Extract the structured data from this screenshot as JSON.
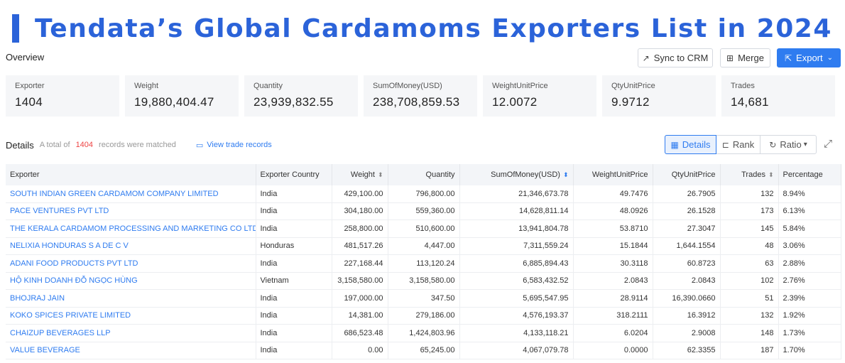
{
  "title": "Tendata’s Global Cardamoms Exporters List in 2024",
  "overview_label": "Overview",
  "buttons": {
    "sync": "Sync to CRM",
    "merge": "Merge",
    "export": "Export"
  },
  "cards": [
    {
      "label": "Exporter",
      "value": "1404"
    },
    {
      "label": "Weight",
      "value": "19,880,404.47"
    },
    {
      "label": "Quantity",
      "value": "23,939,832.55"
    },
    {
      "label": "SumOfMoney(USD)",
      "value": "238,708,859.53"
    },
    {
      "label": "WeightUnitPrice",
      "value": "12.0072"
    },
    {
      "label": "QtyUnitPrice",
      "value": "9.9712"
    },
    {
      "label": "Trades",
      "value": "14,681"
    }
  ],
  "details": {
    "title": "Details",
    "prefix": "A total of",
    "count": "1404",
    "suffix": "records were matched",
    "view_link": "View trade records"
  },
  "view_tabs": {
    "details": "Details",
    "rank": "Rank",
    "ratio": "Ratio"
  },
  "table": {
    "headers": [
      "Exporter",
      "Exporter Country",
      "Weight",
      "Quantity",
      "SumOfMoney(USD)",
      "WeightUnitPrice",
      "QtyUnitPrice",
      "Trades",
      "Percentage"
    ],
    "rows": [
      [
        "SOUTH INDIAN GREEN CARDAMOM COMPANY LIMITED",
        "India",
        "429,100.00",
        "796,800.00",
        "21,346,673.78",
        "49.7476",
        "26.7905",
        "132",
        "8.94%"
      ],
      [
        "PACE VENTURES PVT LTD",
        "India",
        "304,180.00",
        "559,360.00",
        "14,628,811.14",
        "48.0926",
        "26.1528",
        "173",
        "6.13%"
      ],
      [
        "THE KERALA CARDAMOM PROCESSING AND MARKETING CO LTD",
        "India",
        "258,800.00",
        "510,600.00",
        "13,941,804.78",
        "53.8710",
        "27.3047",
        "145",
        "5.84%"
      ],
      [
        "NELIXIA HONDURAS S A DE C V",
        "Honduras",
        "481,517.26",
        "4,447.00",
        "7,311,559.24",
        "15.1844",
        "1,644.1554",
        "48",
        "3.06%"
      ],
      [
        "ADANI FOOD PRODUCTS PVT LTD",
        "India",
        "227,168.44",
        "113,120.24",
        "6,885,894.43",
        "30.3118",
        "60.8723",
        "63",
        "2.88%"
      ],
      [
        "HỘ KINH DOANH ĐỖ NGỌC HÙNG",
        "Vietnam",
        "3,158,580.00",
        "3,158,580.00",
        "6,583,432.52",
        "2.0843",
        "2.0843",
        "102",
        "2.76%"
      ],
      [
        "BHOJRAJ JAIN",
        "India",
        "197,000.00",
        "347.50",
        "5,695,547.95",
        "28.9114",
        "16,390.0660",
        "51",
        "2.39%"
      ],
      [
        "KOKO SPICES PRIVATE LIMITED",
        "India",
        "14,381.00",
        "279,186.00",
        "4,576,193.37",
        "318.2111",
        "16.3912",
        "132",
        "1.92%"
      ],
      [
        "CHAIZUP BEVERAGES LLP",
        "India",
        "686,523.48",
        "1,424,803.96",
        "4,133,118.21",
        "6.0204",
        "2.9008",
        "148",
        "1.73%"
      ],
      [
        "VALUE BEVERAGE",
        "India",
        "0.00",
        "65,245.00",
        "4,067,079.78",
        "0.0000",
        "62.3355",
        "187",
        "1.70%"
      ]
    ]
  }
}
